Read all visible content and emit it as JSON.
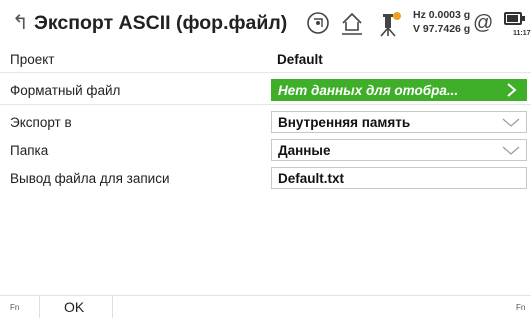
{
  "header": {
    "back_glyph": "↰",
    "title": "Экспорт ASCII (фор.файл)",
    "hz_line": "Hz 0.0003 g",
    "v_line": "V  97.7426 g",
    "at_symbol": "@",
    "time": "11:17"
  },
  "fields": [
    {
      "label": "Проект",
      "value": "Default"
    },
    {
      "label": "Форматный файл",
      "value": "Нет данных для отобра..."
    },
    {
      "label": "Экспорт в",
      "value": "Внутренняя память"
    },
    {
      "label": "Папка",
      "value": "Данные"
    },
    {
      "label": "Вывод файла для записи",
      "value": "Default.txt"
    }
  ],
  "footer": {
    "fn_left": "Fn",
    "ok_label": "OK",
    "fn_right": "Fn"
  },
  "colors": {
    "accent_green": "#3fae29",
    "field_border": "#c8c8c8"
  }
}
